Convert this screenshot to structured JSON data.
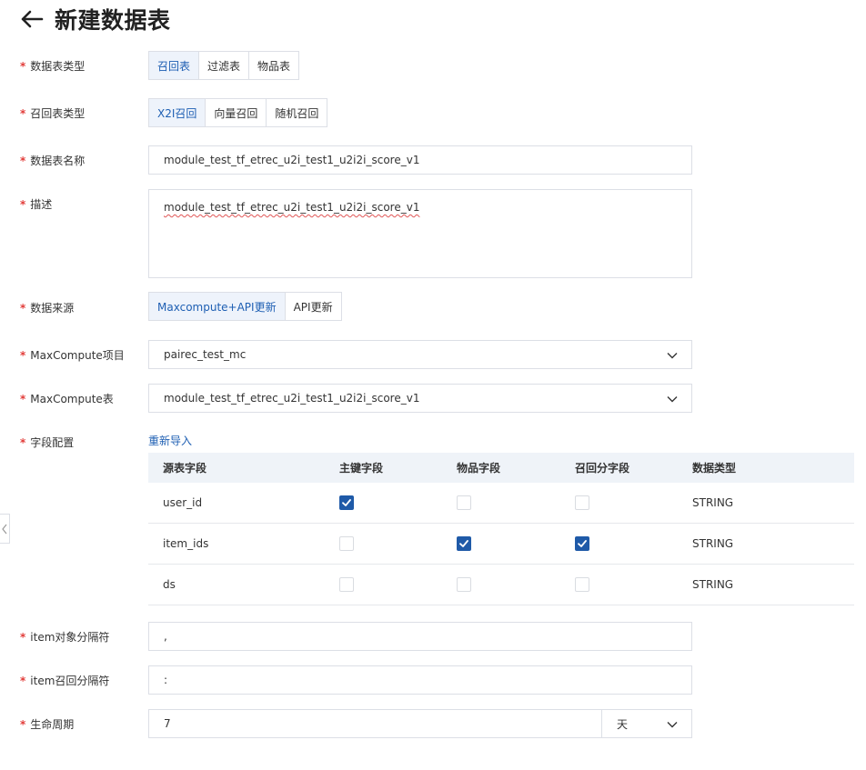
{
  "page": {
    "title": "新建数据表"
  },
  "required_mark": "*",
  "table_type": {
    "label": "数据表类型",
    "options": [
      "召回表",
      "过滤表",
      "物品表"
    ],
    "selected": "召回表"
  },
  "recall_type": {
    "label": "召回表类型",
    "options": [
      "X2I召回",
      "向量召回",
      "随机召回"
    ],
    "selected": "X2I召回"
  },
  "table_name": {
    "label": "数据表名称",
    "value": "module_test_tf_etrec_u2i_test1_u2i2i_score_v1"
  },
  "description": {
    "label": "描述",
    "value": "module_test_tf_etrec_u2i_test1_u2i2i_score_v1"
  },
  "data_source": {
    "label": "数据来源",
    "options": [
      "Maxcompute+API更新",
      "API更新"
    ],
    "selected": "Maxcompute+API更新"
  },
  "mc_project": {
    "label": "MaxCompute项目",
    "value": "pairec_test_mc"
  },
  "mc_table": {
    "label": "MaxCompute表",
    "value": "module_test_tf_etrec_u2i_test1_u2i2i_score_v1"
  },
  "field_config": {
    "label": "字段配置",
    "reimport_label": "重新导入",
    "columns": [
      "源表字段",
      "主键字段",
      "物品字段",
      "召回分字段",
      "数据类型"
    ],
    "rows": [
      {
        "field": "user_id",
        "primary_key": true,
        "item_field": false,
        "score_field": false,
        "type": "STRING"
      },
      {
        "field": "item_ids",
        "primary_key": false,
        "item_field": true,
        "score_field": true,
        "type": "STRING"
      },
      {
        "field": "ds",
        "primary_key": false,
        "item_field": false,
        "score_field": false,
        "type": "STRING"
      }
    ]
  },
  "item_separator": {
    "label": "item对象分隔符",
    "value": ","
  },
  "item_score_separator": {
    "label": "item召回分隔符",
    "value": ":"
  },
  "lifecycle": {
    "label": "生命周期",
    "value": "7",
    "unit": "天"
  },
  "colors": {
    "accent": "#1e5fb3",
    "required": "#e23c39",
    "checkbox": "#1f5aa8",
    "header_bg": "#eff3f8"
  },
  "icons": {
    "back": "arrow-left-icon",
    "dropdown": "chevron-down-icon",
    "collapse": "chevron-left-icon",
    "check": "check-icon"
  }
}
